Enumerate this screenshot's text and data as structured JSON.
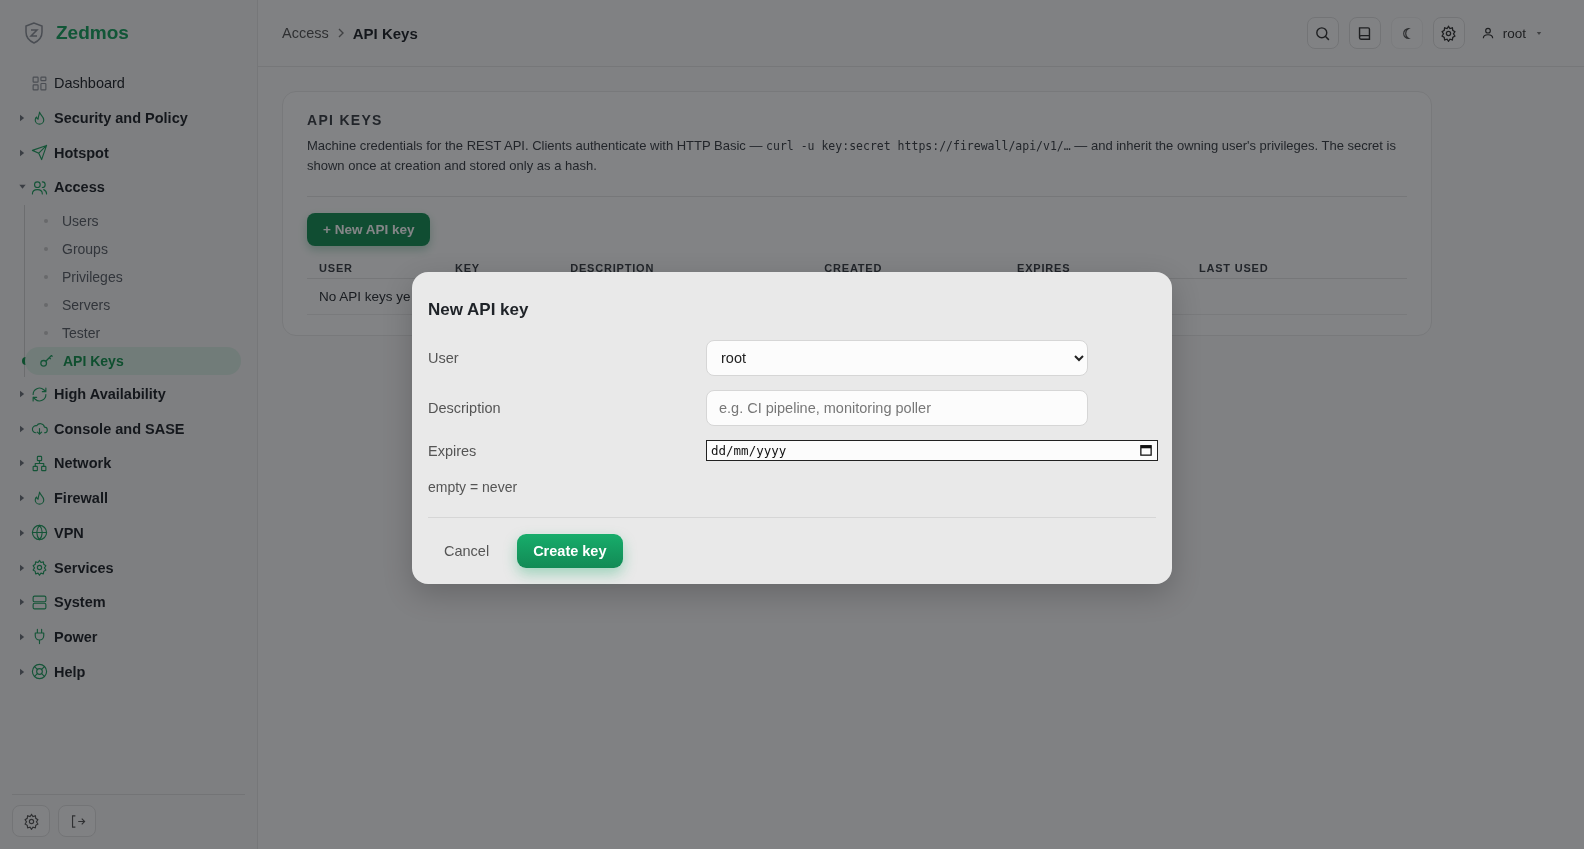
{
  "brand": "Zedmos",
  "sidebar": {
    "items": [
      {
        "label": "Dashboard",
        "kind": "link"
      },
      {
        "label": "Security and Policy",
        "kind": "group",
        "expanded": false
      },
      {
        "label": "Hotspot",
        "kind": "group",
        "expanded": false
      },
      {
        "label": "Access",
        "kind": "group",
        "expanded": true,
        "children": [
          {
            "label": "Users",
            "selected": false
          },
          {
            "label": "Groups",
            "selected": false
          },
          {
            "label": "Privileges",
            "selected": false
          },
          {
            "label": "Servers",
            "selected": false
          },
          {
            "label": "Tester",
            "selected": false
          },
          {
            "label": "API Keys",
            "selected": true
          }
        ]
      },
      {
        "label": "High Availability",
        "kind": "group",
        "expanded": false
      },
      {
        "label": "Console and SASE",
        "kind": "group",
        "expanded": false
      },
      {
        "label": "Network",
        "kind": "group",
        "expanded": false
      },
      {
        "label": "Firewall",
        "kind": "group",
        "expanded": false
      },
      {
        "label": "VPN",
        "kind": "group",
        "expanded": false
      },
      {
        "label": "Services",
        "kind": "group",
        "expanded": false
      },
      {
        "label": "System",
        "kind": "group",
        "expanded": false
      },
      {
        "label": "Power",
        "kind": "group",
        "expanded": false
      },
      {
        "label": "Help",
        "kind": "group",
        "expanded": false
      }
    ]
  },
  "breadcrumb": [
    "Access",
    "API Keys"
  ],
  "user_menu": {
    "label": "root"
  },
  "card": {
    "title": "API KEYS",
    "description": [
      "Machine credentials for the REST API. Clients authenticate with HTTP Basic — ",
      "curl -u key:secret https://firewall/api/v1/…",
      " — and inherit the owning user's privileges. The secret is shown once at creation and stored only as a hash."
    ],
    "new_button": "+ New API key",
    "table": {
      "columns": [
        "USER",
        "KEY",
        "DESCRIPTION",
        "CREATED",
        "EXPIRES",
        "LAST USED"
      ],
      "empty": "No API keys ye"
    }
  },
  "dialog": {
    "title": "New API key",
    "fields": [
      {
        "label": "User",
        "kind": "select",
        "value": "root"
      },
      {
        "label": "Description",
        "kind": "text",
        "placeholder": "e.g. CI pipeline, monitoring poller"
      },
      {
        "label": "Expires",
        "kind": "date",
        "placeholder": "dd/mm/yyyy",
        "hint": "empty = never"
      }
    ],
    "cancel": "Cancel",
    "submit": "Create key"
  }
}
